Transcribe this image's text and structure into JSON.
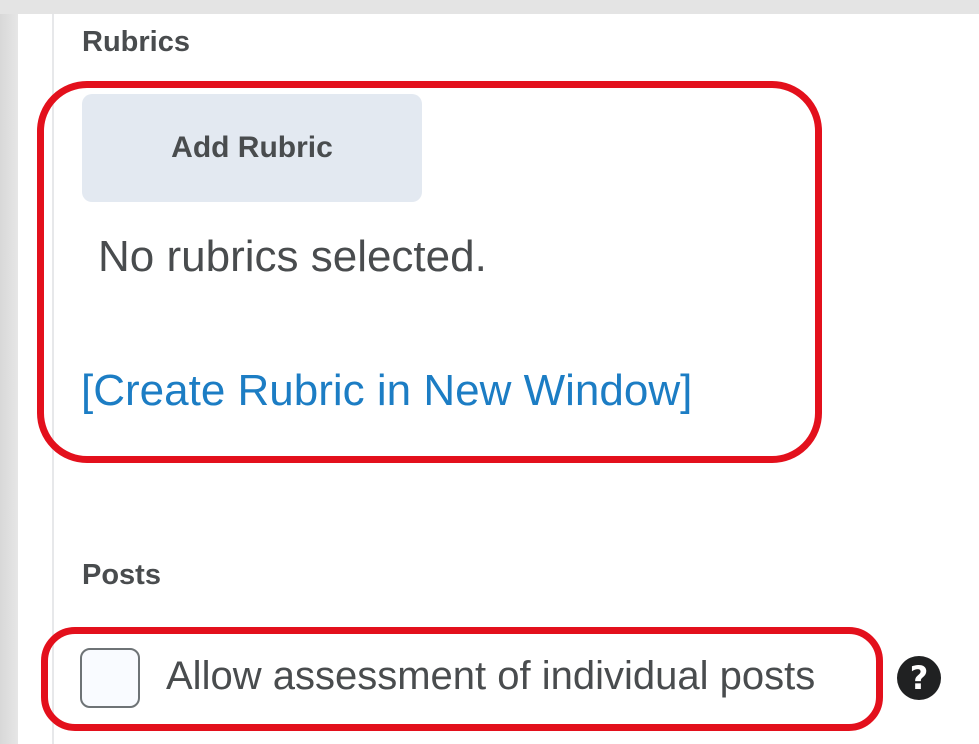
{
  "rubrics": {
    "heading": "Rubrics",
    "add_button_label": "Add Rubric",
    "empty_message": "No rubrics selected.",
    "create_link_label": "[Create Rubric in New Window]"
  },
  "posts": {
    "heading": "Posts",
    "allow_assessment_label": "Allow assessment of individual posts",
    "allow_assessment_checked": false,
    "help_icon_glyph": "?"
  },
  "colors": {
    "highlight": "#e3101c",
    "link": "#1c7dc4",
    "button_bg": "#e3e9f1",
    "text": "#494c4e"
  },
  "icons": {
    "help": "help-question-icon"
  }
}
